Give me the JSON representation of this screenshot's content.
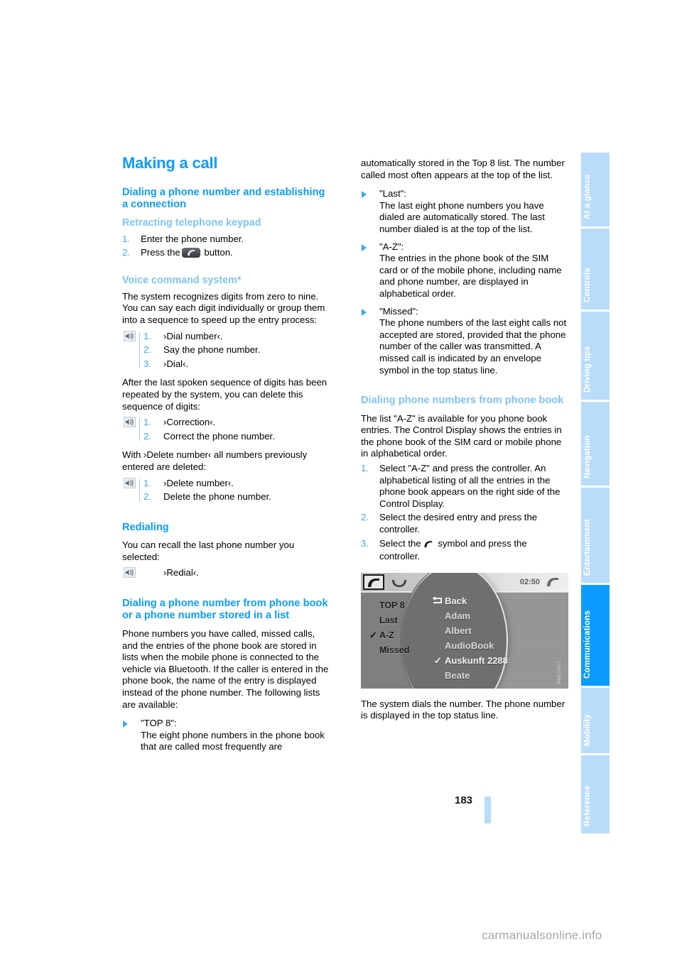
{
  "page": {
    "number": "183",
    "watermark": "carmanualsonline.info"
  },
  "tabs": [
    {
      "label": "At a glance",
      "active": false
    },
    {
      "label": "Controls",
      "active": false
    },
    {
      "label": "Driving tips",
      "active": false
    },
    {
      "label": "Navigation",
      "active": false
    },
    {
      "label": "Entertainment",
      "active": false
    },
    {
      "label": "Communications",
      "active": true
    },
    {
      "label": "Mobility",
      "active": false
    },
    {
      "label": "Reference",
      "active": false
    }
  ],
  "left": {
    "title": "Making a call",
    "section1_heading": "Dialing a phone number and establishing a connection",
    "sub1_heading": "Retracting telephone keypad",
    "sub1_steps": [
      {
        "num": "1.",
        "text": "Enter the phone number."
      },
      {
        "num": "2.",
        "text_before": "Press the",
        "text_after": "button."
      }
    ],
    "sub2_heading": "Voice command system*",
    "sub2_para": "The system recognizes digits from zero to nine. You can say each digit individually or group them into a sequence to speed up the entry process:",
    "voice_block1": [
      {
        "num": "1.",
        "text": "›Dial number‹."
      },
      {
        "num": "2.",
        "text": "Say the phone number."
      },
      {
        "num": "3.",
        "text": "›Dial‹."
      }
    ],
    "after_para": "After the last spoken sequence of digits has been repeated by the system, you can delete this sequence of digits:",
    "voice_block2": [
      {
        "num": "1.",
        "text": "›Correction‹."
      },
      {
        "num": "2.",
        "text": "Correct the phone number."
      }
    ],
    "delete_para": "With ›Delete number‹ all numbers previously entered are deleted:",
    "voice_block3": [
      {
        "num": "1.",
        "text": "›Delete number‹."
      },
      {
        "num": "2.",
        "text": "Delete the phone number."
      }
    ],
    "sub3_heading": "Redialing",
    "sub3_para": "You can recall the last phone number you selected:",
    "voice_block4_text": "›Redial‹.",
    "section2_heading": "Dialing a phone number from phone book or a phone number stored in a list",
    "section2_para": "Phone numbers you have called, missed calls, and the entries of the phone book are stored in lists when the mobile phone is connected to the vehicle via Bluetooth. If the caller is entered in the phone book, the name of the entry is displayed instead of the phone number. The following lists are available:",
    "bullet_top8": "\"TOP 8\":\nThe eight phone numbers in the phone book that are called most frequently are"
  },
  "right": {
    "continuation": "automatically stored in the Top 8 list. The number called most often appears at the top of the list.",
    "bullets": [
      {
        "title": "\"Last\":",
        "body": "The last eight phone numbers you have dialed are automatically stored. The last number dialed is at the top of the list."
      },
      {
        "title": "\"A-Z\":",
        "body": "The entries in the phone book of the SIM card or of the mobile phone, including name and phone number, are displayed in alphabetical order."
      },
      {
        "title": "\"Missed\":",
        "body": "The phone numbers of the last eight calls not accepted are stored, provided that the phone number of the caller was transmitted. A missed call is indicated by an envelope symbol in the top status line."
      }
    ],
    "section_heading": "Dialing phone numbers from phone book",
    "section_para": "The list \"A-Z\" is available for you phone book entries. The Control Display shows the entries in the phone book of the SIM card or mobile phone in alphabetical order.",
    "steps": [
      {
        "num": "1.",
        "text": "Select \"A-Z\" and press the controller. An alphabetical listing of all the entries in the phone book appears on the right side of the Control Display."
      },
      {
        "num": "2.",
        "text": "Select the desired entry and press the controller."
      },
      {
        "num": "3.",
        "text_before": "Select the",
        "text_after": "symbol and press the controller."
      }
    ],
    "closing_para": "The system dials the number. The phone number is displayed in the top status line."
  },
  "control_display": {
    "clock": "02:50",
    "fig_code": "MM0200-1",
    "left_menu": [
      {
        "label": "TOP 8",
        "checked": false
      },
      {
        "label": "Last",
        "checked": false
      },
      {
        "label": "A-Z",
        "checked": true
      },
      {
        "label": "Missed",
        "checked": false
      }
    ],
    "right_list": [
      {
        "label": "Back",
        "checked": false,
        "icon": "back-arrow-icon"
      },
      {
        "label": "Adam",
        "checked": false
      },
      {
        "label": "Albert",
        "checked": false
      },
      {
        "label": "AudioBook",
        "checked": false
      },
      {
        "label": "Auskunft 2288",
        "checked": true
      },
      {
        "label": "Beate",
        "checked": false
      }
    ]
  },
  "colors": {
    "accent": "#0c9cff",
    "accent_light": "#7fc4f7",
    "tab_inactive": "#b9dcfb",
    "tab_active": "#0c9cff"
  }
}
